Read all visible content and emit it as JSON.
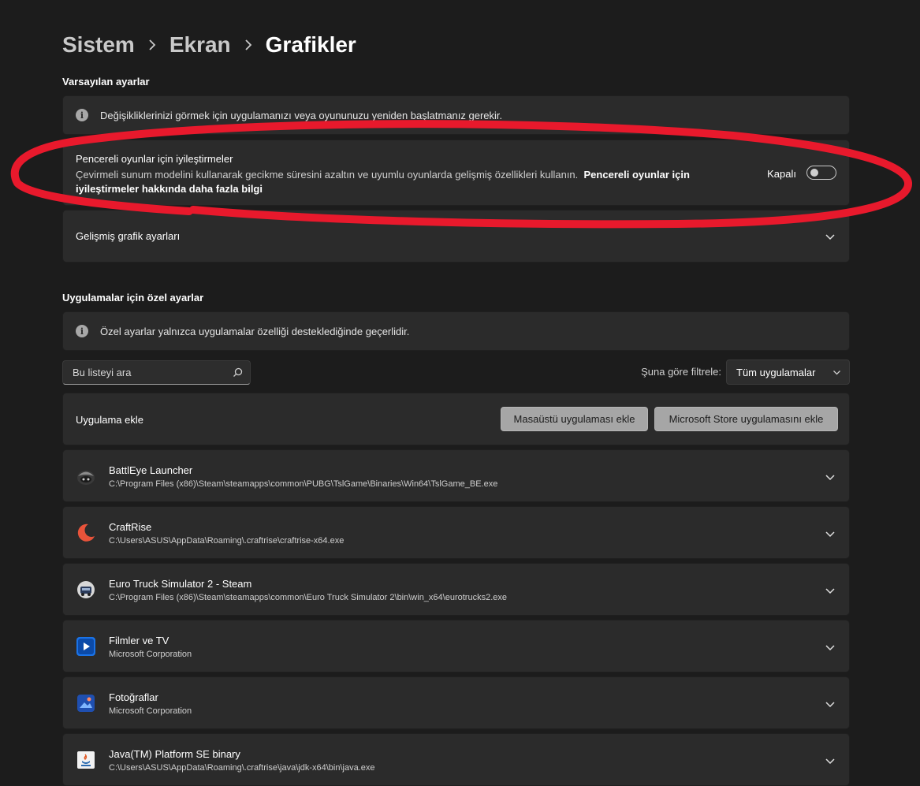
{
  "breadcrumb": {
    "items": [
      "Sistem",
      "Ekran"
    ],
    "current": "Grafikler"
  },
  "default_settings": {
    "title": "Varsayılan ayarlar",
    "info_text": "Değişikliklerinizi görmek için uygulamanızı veya oyununuzu yeniden başlatmanız gerekir.",
    "windowed_games": {
      "title": "Pencereli oyunlar için iyileştirmeler",
      "description": "Çevirmeli sunum modelini kullanarak gecikme süresini azaltın ve uyumlu oyunlarda gelişmiş özellikleri kullanın.",
      "link_text": "Pencereli oyunlar için iyileştirmeler hakkında daha fazla bilgi",
      "toggle_state_label": "Kapalı",
      "toggle_on": false
    },
    "advanced_graphics_label": "Gelişmiş grafik ayarları"
  },
  "app_settings": {
    "title": "Uygulamalar için özel ayarlar",
    "info_text": "Özel ayarlar yalnızca uygulamalar özelliği desteklediğinde geçerlidir.",
    "search_placeholder": "Bu listeyi ara",
    "filter_label": "Şuna göre filtrele:",
    "filter_value": "Tüm uygulamalar",
    "add_app_label": "Uygulama ekle",
    "add_desktop_button": "Masaüstü uygulaması ekle",
    "add_store_button": "Microsoft Store uygulamasını ekle"
  },
  "apps": [
    {
      "name": "BattlEye Launcher",
      "path": "C:\\Program Files (x86)\\Steam\\steamapps\\common\\PUBG\\TslGame\\Binaries\\Win64\\TslGame_BE.exe",
      "icon": "battleye-icon"
    },
    {
      "name": "CraftRise",
      "path": "C:\\Users\\ASUS\\AppData\\Roaming\\.craftrise\\craftrise-x64.exe",
      "icon": "craftrise-icon"
    },
    {
      "name": "Euro Truck Simulator 2 - Steam",
      "path": "C:\\Program Files (x86)\\Steam\\steamapps\\common\\Euro Truck Simulator 2\\bin\\win_x64\\eurotrucks2.exe",
      "icon": "ets2-icon"
    },
    {
      "name": "Filmler ve TV",
      "path": "Microsoft Corporation",
      "icon": "movies-tv-icon"
    },
    {
      "name": "Fotoğraflar",
      "path": "Microsoft Corporation",
      "icon": "photos-icon"
    },
    {
      "name": "Java(TM) Platform SE binary",
      "path": "C:\\Users\\ASUS\\AppData\\Roaming\\.craftrise\\java\\jdk-x64\\bin\\java.exe",
      "icon": "java-icon"
    }
  ],
  "colors": {
    "background": "#1c1c1c",
    "card": "#2b2b2b",
    "annotation_red": "#e8192c",
    "button": "#a6a6a6"
  }
}
